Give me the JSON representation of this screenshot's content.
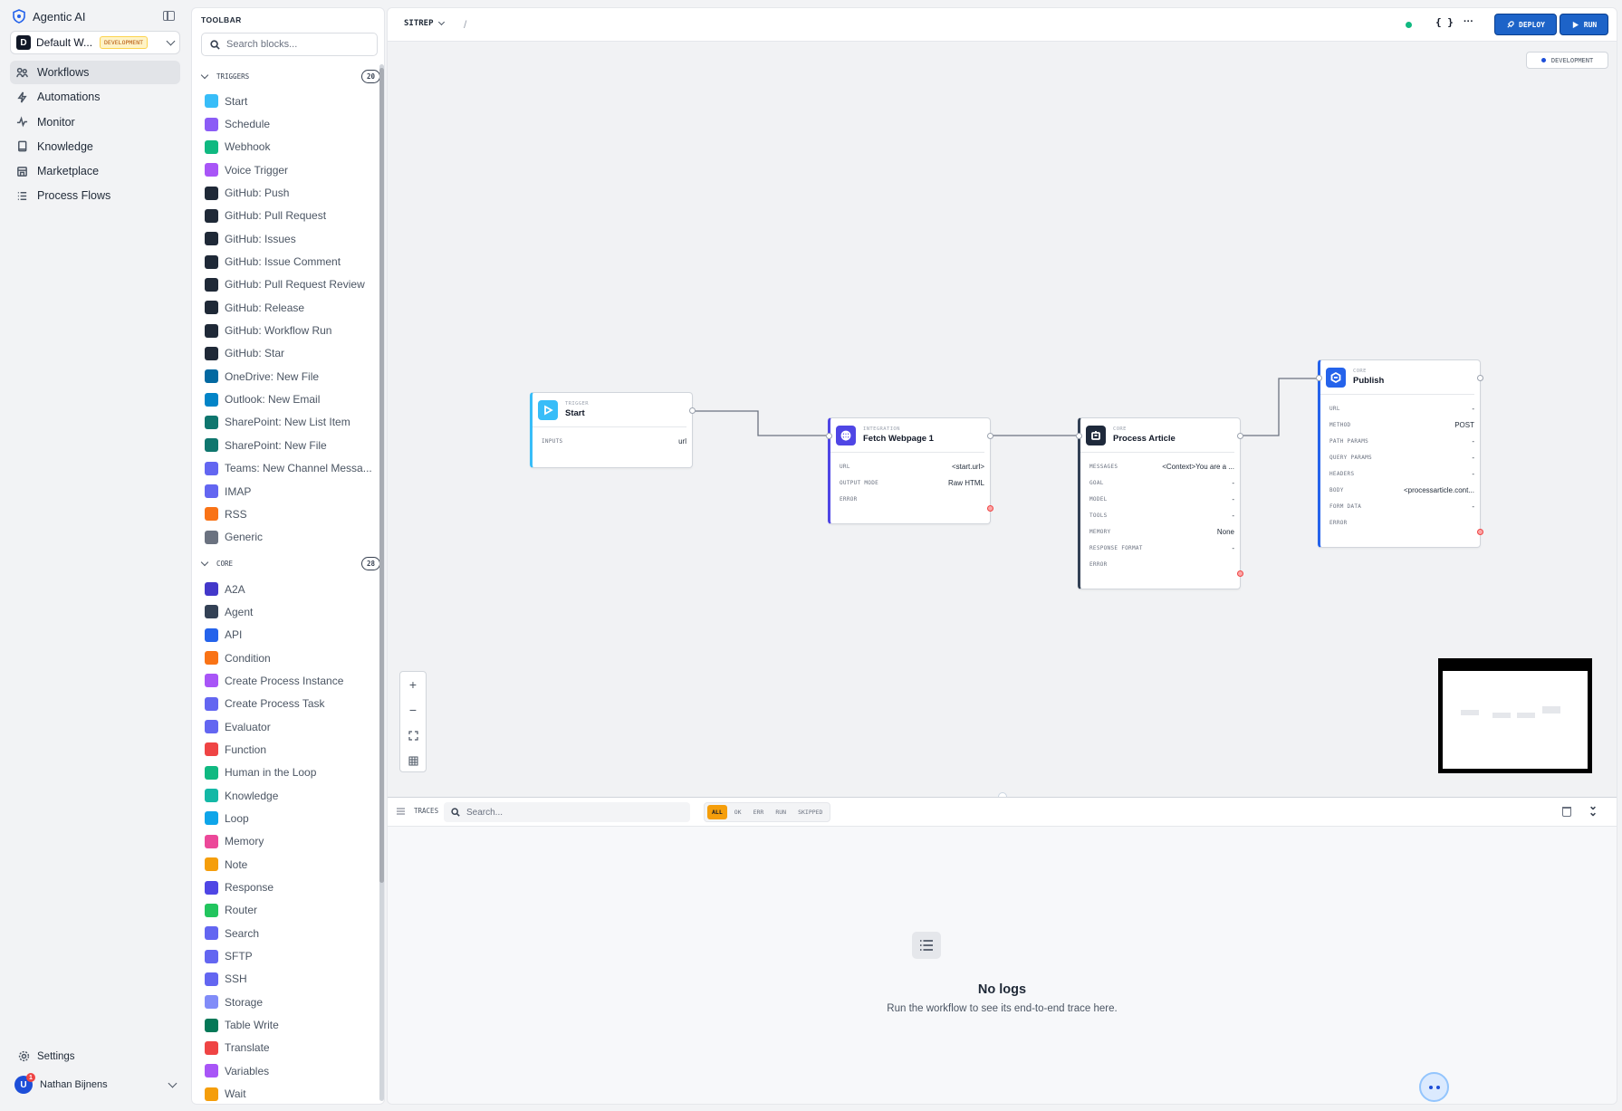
{
  "app": {
    "brand": "Agentic AI",
    "workspace_initial": "D",
    "workspace_name": "Default W...",
    "workspace_badge": "DEVELOPMENT"
  },
  "nav": [
    {
      "label": "Workflows",
      "icon": "workflows-icon",
      "active": true
    },
    {
      "label": "Automations",
      "icon": "bolt-icon"
    },
    {
      "label": "Monitor",
      "icon": "activity-icon"
    },
    {
      "label": "Knowledge",
      "icon": "book-icon"
    },
    {
      "label": "Marketplace",
      "icon": "store-icon"
    },
    {
      "label": "Process Flows",
      "icon": "list-icon"
    }
  ],
  "footer": {
    "settings": "Settings",
    "user_name": "Nathan Bijnens",
    "user_initial": "U",
    "notification_count": "1"
  },
  "toolbar": {
    "title": "TOOLBAR",
    "search_placeholder": "Search blocks...",
    "triggers": {
      "label": "TRIGGERS",
      "count": "20",
      "items": [
        {
          "label": "Start",
          "color": "#38bdf8"
        },
        {
          "label": "Schedule",
          "color": "#8b5cf6"
        },
        {
          "label": "Webhook",
          "color": "#10b981"
        },
        {
          "label": "Voice Trigger",
          "color": "#a855f7"
        },
        {
          "label": "GitHub: Push",
          "color": "#1f2937"
        },
        {
          "label": "GitHub: Pull Request",
          "color": "#1f2937"
        },
        {
          "label": "GitHub: Issues",
          "color": "#1f2937"
        },
        {
          "label": "GitHub: Issue Comment",
          "color": "#1f2937"
        },
        {
          "label": "GitHub: Pull Request Review",
          "color": "#1f2937"
        },
        {
          "label": "GitHub: Release",
          "color": "#1f2937"
        },
        {
          "label": "GitHub: Workflow Run",
          "color": "#1f2937"
        },
        {
          "label": "GitHub: Star",
          "color": "#1f2937"
        },
        {
          "label": "OneDrive: New File",
          "color": "#0369a1"
        },
        {
          "label": "Outlook: New Email",
          "color": "#0284c7"
        },
        {
          "label": "SharePoint: New List Item",
          "color": "#0f766e"
        },
        {
          "label": "SharePoint: New File",
          "color": "#0f766e"
        },
        {
          "label": "Teams: New Channel Messa...",
          "color": "#6366f1"
        },
        {
          "label": "IMAP",
          "color": "#6366f1"
        },
        {
          "label": "RSS",
          "color": "#f97316"
        },
        {
          "label": "Generic",
          "color": "#6b7280"
        }
      ]
    },
    "core": {
      "label": "CORE",
      "count": "28",
      "items": [
        {
          "label": "A2A",
          "color": "#4338ca"
        },
        {
          "label": "Agent",
          "color": "#334155"
        },
        {
          "label": "API",
          "color": "#2563eb"
        },
        {
          "label": "Condition",
          "color": "#f97316"
        },
        {
          "label": "Create Process Instance",
          "color": "#a855f7"
        },
        {
          "label": "Create Process Task",
          "color": "#6366f1"
        },
        {
          "label": "Evaluator",
          "color": "#6366f1"
        },
        {
          "label": "Function",
          "color": "#ef4444"
        },
        {
          "label": "Human in the Loop",
          "color": "#10b981"
        },
        {
          "label": "Knowledge",
          "color": "#14b8a6"
        },
        {
          "label": "Loop",
          "color": "#0ea5e9"
        },
        {
          "label": "Memory",
          "color": "#ec4899"
        },
        {
          "label": "Note",
          "color": "#f59e0b"
        },
        {
          "label": "Response",
          "color": "#4f46e5"
        },
        {
          "label": "Router",
          "color": "#22c55e"
        },
        {
          "label": "Search",
          "color": "#6366f1"
        },
        {
          "label": "SFTP",
          "color": "#6366f1"
        },
        {
          "label": "SSH",
          "color": "#6366f1"
        },
        {
          "label": "Storage",
          "color": "#818cf8"
        },
        {
          "label": "Table Write",
          "color": "#047857"
        },
        {
          "label": "Translate",
          "color": "#ef4444"
        },
        {
          "label": "Variables",
          "color": "#a855f7"
        },
        {
          "label": "Wait",
          "color": "#f59e0b"
        }
      ]
    }
  },
  "canvas": {
    "workflow_name": "SITREP",
    "breadcrumb_sep": "/",
    "json_btn": "{ }",
    "more_btn": "···",
    "deploy_label": "DEPLOY",
    "run_label": "RUN",
    "env_label": "DEVELOPMENT",
    "nodes": {
      "start": {
        "type": "TRIGGER",
        "title": "Start",
        "rows": [
          {
            "k": "INPUTS",
            "v": "url"
          }
        ]
      },
      "fetch": {
        "type": "INTEGRATION",
        "title": "Fetch Webpage 1",
        "rows": [
          {
            "k": "URL",
            "v": "<start.url>"
          },
          {
            "k": "OUTPUT MODE",
            "v": "Raw HTML"
          },
          {
            "k": "ERROR",
            "v": ""
          }
        ]
      },
      "process": {
        "type": "CORE",
        "title": "Process Article",
        "rows": [
          {
            "k": "MESSAGES",
            "v": "<Context>You are a ..."
          },
          {
            "k": "GOAL",
            "v": "-"
          },
          {
            "k": "MODEL",
            "v": "-"
          },
          {
            "k": "TOOLS",
            "v": "-"
          },
          {
            "k": "MEMORY",
            "v": "None"
          },
          {
            "k": "RESPONSE FORMAT",
            "v": "-"
          },
          {
            "k": "ERROR",
            "v": ""
          }
        ]
      },
      "publish": {
        "type": "CORE",
        "title": "Publish",
        "rows": [
          {
            "k": "URL",
            "v": "-"
          },
          {
            "k": "METHOD",
            "v": "POST"
          },
          {
            "k": "PATH PARAMS",
            "v": "-"
          },
          {
            "k": "QUERY PARAMS",
            "v": "-"
          },
          {
            "k": "HEADERS",
            "v": "-"
          },
          {
            "k": "BODY",
            "v": "<processarticle.cont..."
          },
          {
            "k": "FORM DATA",
            "v": "-"
          },
          {
            "k": "ERROR",
            "v": ""
          }
        ]
      }
    }
  },
  "logs": {
    "traces_label": "TRACES",
    "search_placeholder": "Search...",
    "filters": [
      "ALL",
      "OK",
      "ERR",
      "RUN",
      "SKIPPED"
    ],
    "active_filter": "ALL",
    "empty_title": "No logs",
    "empty_sub": "Run the workflow to see its end-to-end trace here."
  }
}
